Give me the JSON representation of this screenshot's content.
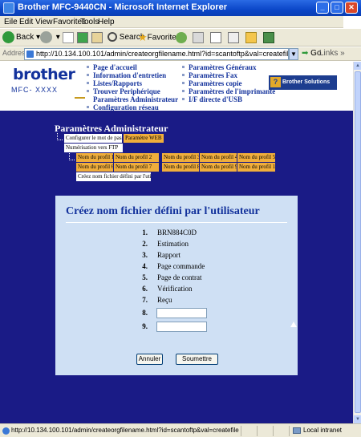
{
  "window": {
    "title": "Brother MFC-9440CN - Microsoft Internet Explorer"
  },
  "menu": [
    "Eile",
    "Edit",
    "View",
    "Favorites",
    "Tools",
    "Help"
  ],
  "toolbar": {
    "back": "Back",
    "search": "Search",
    "favorites": "Favorites"
  },
  "address": {
    "label": "Address",
    "url": "http://10.134.100.101/admin/createorgfilename.html?id=scantoftp&val=createfile",
    "go": "Go",
    "links": "Links"
  },
  "header": {
    "logo": "brother",
    "model": "MFC- XXXX",
    "nav_left": [
      "Page d'accueil",
      "Information d'entretien",
      "Listes/Rapports",
      "Trouver Periphérique",
      "Paramètres Administrateur",
      "Configuration réseau"
    ],
    "nav_right": [
      "Paramètres Généraux",
      "Paramètres Fax",
      "Paramètres copie",
      "Paramètres de l'imprimante",
      "I/F directe d'USB"
    ],
    "solutions": "Brother Solutions Center"
  },
  "section": {
    "title": "Paramètres Administrateur",
    "tabs_row1": [
      "Configurer le mot de passe",
      "Paramètre WEB"
    ],
    "numerisation": "Numérisation vers FTP",
    "profiles_row1": [
      "Nom du profil 1",
      "Nom du profil 2",
      "Nom du profil 3",
      "Nom du profil 4",
      "Nom du profil 5"
    ],
    "profiles_row2": [
      "Nom du profil 6",
      "Nom du profil 7",
      "Nom du profil 8",
      "Nom du profil 9",
      "Nom du profil 10"
    ],
    "create_tab": "Créez nom fichier défini par l'utilisateur"
  },
  "panel": {
    "title": "Créez nom fichier défini par l'utilisateur",
    "items": [
      {
        "num": "1.",
        "label": "BRN884C0D"
      },
      {
        "num": "2.",
        "label": "Estimation"
      },
      {
        "num": "3.",
        "label": "Rapport"
      },
      {
        "num": "4.",
        "label": "Page commande"
      },
      {
        "num": "5.",
        "label": "Page de contrat"
      },
      {
        "num": "6.",
        "label": "Vérification"
      },
      {
        "num": "7.",
        "label": "Reçu"
      },
      {
        "num": "8.",
        "label": ""
      },
      {
        "num": "9.",
        "label": ""
      }
    ],
    "field8_value": "",
    "field9_value": "",
    "cancel": "Annuler",
    "submit": "Soumettre"
  },
  "status": {
    "url": "http://10.134.100.101/admin/createorgfilename.html?id=scantoftp&val=createfile",
    "zone": "Local intranet"
  },
  "colors": {
    "page_blue": "#1a1b86",
    "panel": "#cfe0f4",
    "tab_orange": "#f0ae3c",
    "link_blue": "#13329c"
  }
}
